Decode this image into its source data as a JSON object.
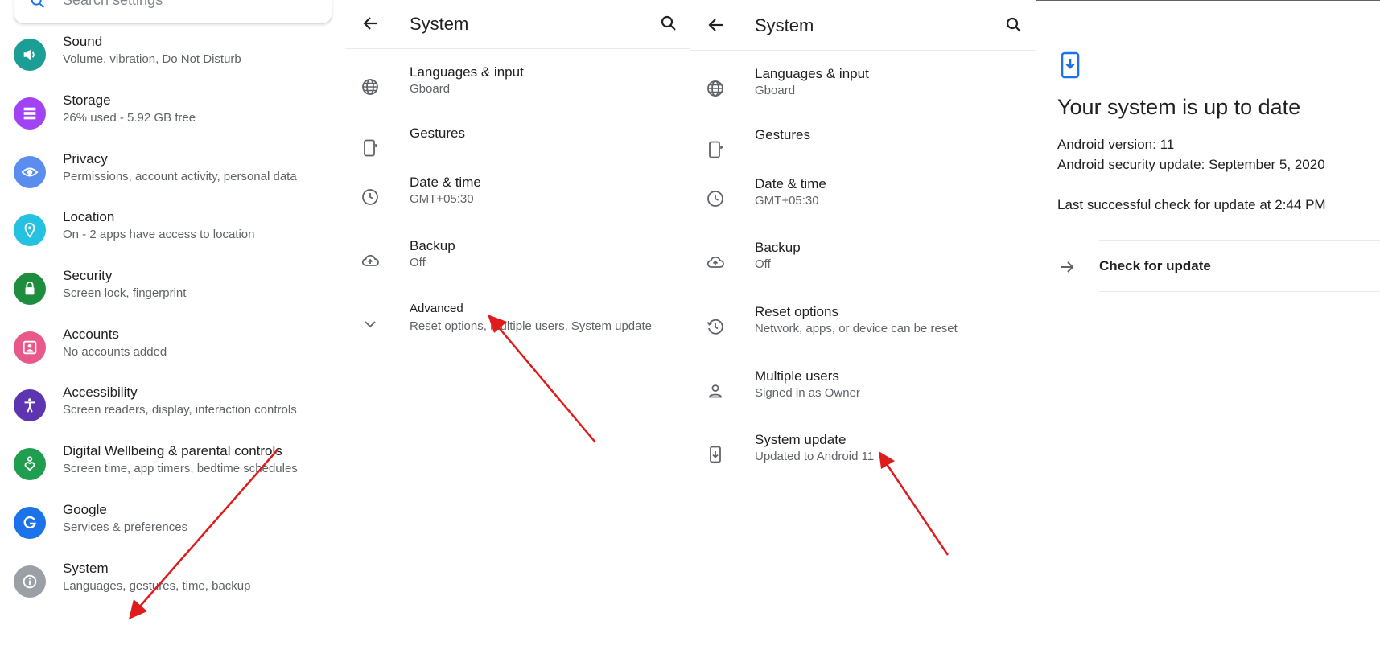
{
  "panel1": {
    "search_placeholder": "Search settings",
    "items": [
      {
        "title": "Sound",
        "subtitle": "Volume, vibration, Do Not Disturb",
        "icon": "volume-icon",
        "color": "#1a9e96"
      },
      {
        "title": "Storage",
        "subtitle": "26% used - 5.92 GB free",
        "icon": "storage-icon",
        "color": "#a142f4"
      },
      {
        "title": "Privacy",
        "subtitle": "Permissions, account activity, personal data",
        "icon": "eye-icon",
        "color": "#5b8def"
      },
      {
        "title": "Location",
        "subtitle": "On - 2 apps have access to location",
        "icon": "location-pin-icon",
        "color": "#24c1e0"
      },
      {
        "title": "Security",
        "subtitle": "Screen lock, fingerprint",
        "icon": "lock-icon",
        "color": "#1e8e3e"
      },
      {
        "title": "Accounts",
        "subtitle": "No accounts added",
        "icon": "account-box-icon",
        "color": "#e8598a"
      },
      {
        "title": "Accessibility",
        "subtitle": "Screen readers, display, interaction controls",
        "icon": "accessibility-icon",
        "color": "#5e35b1"
      },
      {
        "title": "Digital Wellbeing & parental controls",
        "subtitle": "Screen time, app timers, bedtime schedules",
        "icon": "wellbeing-heart-icon",
        "color": "#1e9e4e"
      },
      {
        "title": "Google",
        "subtitle": "Services & preferences",
        "icon": "google-icon",
        "color": "#1a73e8"
      },
      {
        "title": "System",
        "subtitle": "Languages, gestures, time, backup",
        "icon": "info-icon",
        "color": "#9aa0a6"
      }
    ]
  },
  "panel2": {
    "title": "System",
    "items": [
      {
        "title": "Languages & input",
        "subtitle": "Gboard",
        "icon": "globe-icon"
      },
      {
        "title": "Gestures",
        "subtitle": "",
        "icon": "gesture-phone-icon"
      },
      {
        "title": "Date & time",
        "subtitle": "GMT+05:30",
        "icon": "clock-icon"
      },
      {
        "title": "Backup",
        "subtitle": "Off",
        "icon": "cloud-upload-icon"
      },
      {
        "title": "Advanced",
        "subtitle": "Reset options, Multiple users, System update",
        "icon": "chevron-down-icon"
      }
    ]
  },
  "panel3": {
    "title": "System",
    "items": [
      {
        "title": "Languages & input",
        "subtitle": "Gboard",
        "icon": "globe-icon"
      },
      {
        "title": "Gestures",
        "subtitle": "",
        "icon": "gesture-phone-icon"
      },
      {
        "title": "Date & time",
        "subtitle": "GMT+05:30",
        "icon": "clock-icon"
      },
      {
        "title": "Backup",
        "subtitle": "Off",
        "icon": "cloud-upload-icon"
      },
      {
        "title": "Reset options",
        "subtitle": "Network, apps, or device can be reset",
        "icon": "history-icon"
      },
      {
        "title": "Multiple users",
        "subtitle": "Signed in as Owner",
        "icon": "person-icon"
      },
      {
        "title": "System update",
        "subtitle": "Updated to Android 11",
        "icon": "system-update-icon"
      }
    ]
  },
  "panel4": {
    "headline": "Your system is up to date",
    "android_version": "Android version: 11",
    "security_update": "Android security update: September 5, 2020",
    "last_check": "Last successful check for update at 2:44 PM",
    "check_button": "Check for update"
  },
  "colors": {
    "annotation_arrow": "#e01b1b",
    "accent": "#1a73e8"
  }
}
